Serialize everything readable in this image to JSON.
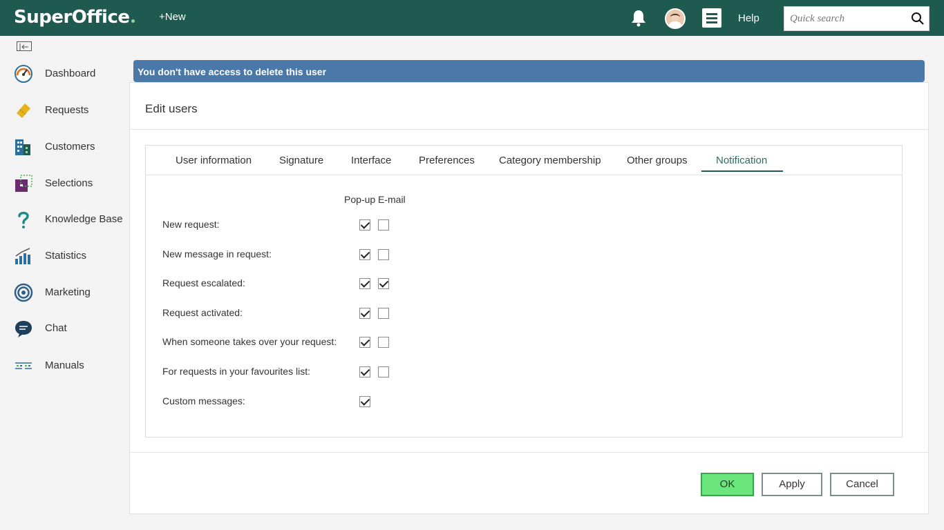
{
  "header": {
    "logo": "SuperOffice",
    "new_label": "+New",
    "help_label": "Help",
    "search_placeholder": "Quick search"
  },
  "sidebar": {
    "items": [
      {
        "label": "Dashboard",
        "icon": "dashboard-gauge-icon"
      },
      {
        "label": "Requests",
        "icon": "ticket-icon"
      },
      {
        "label": "Customers",
        "icon": "building-icon"
      },
      {
        "label": "Selections",
        "icon": "selection-icon"
      },
      {
        "label": "Knowledge Base",
        "icon": "question-mark-icon"
      },
      {
        "label": "Statistics",
        "icon": "bar-chart-icon"
      },
      {
        "label": "Marketing",
        "icon": "target-icon"
      },
      {
        "label": "Chat",
        "icon": "chat-bubble-icon"
      },
      {
        "label": "Manuals",
        "icon": "manual-icon"
      }
    ]
  },
  "alert": {
    "text": "You don't have access to delete this user"
  },
  "panel": {
    "title": "Edit users",
    "tabs": [
      "User information",
      "Signature",
      "Interface",
      "Preferences",
      "Category membership",
      "Other groups",
      "Notification"
    ],
    "active_tab": "Notification",
    "columns": {
      "popup": "Pop-up",
      "email": "E-mail"
    },
    "rows": [
      {
        "label": "New request:",
        "popup": true,
        "email": false
      },
      {
        "label": "New message in request:",
        "popup": true,
        "email": false
      },
      {
        "label": "Request escalated:",
        "popup": true,
        "email": true
      },
      {
        "label": "Request activated:",
        "popup": true,
        "email": false
      },
      {
        "label": "When someone takes over your request:",
        "popup": true,
        "email": false
      },
      {
        "label": "For requests in your favourites list:",
        "popup": true,
        "email": false
      },
      {
        "label": "Custom messages:",
        "popup": true,
        "email": null
      }
    ]
  },
  "buttons": {
    "ok": "OK",
    "apply": "Apply",
    "cancel": "Cancel"
  },
  "colors": {
    "header": "#1e5a4f",
    "alert": "#4a79a9",
    "ok_button": "#6be67d"
  }
}
